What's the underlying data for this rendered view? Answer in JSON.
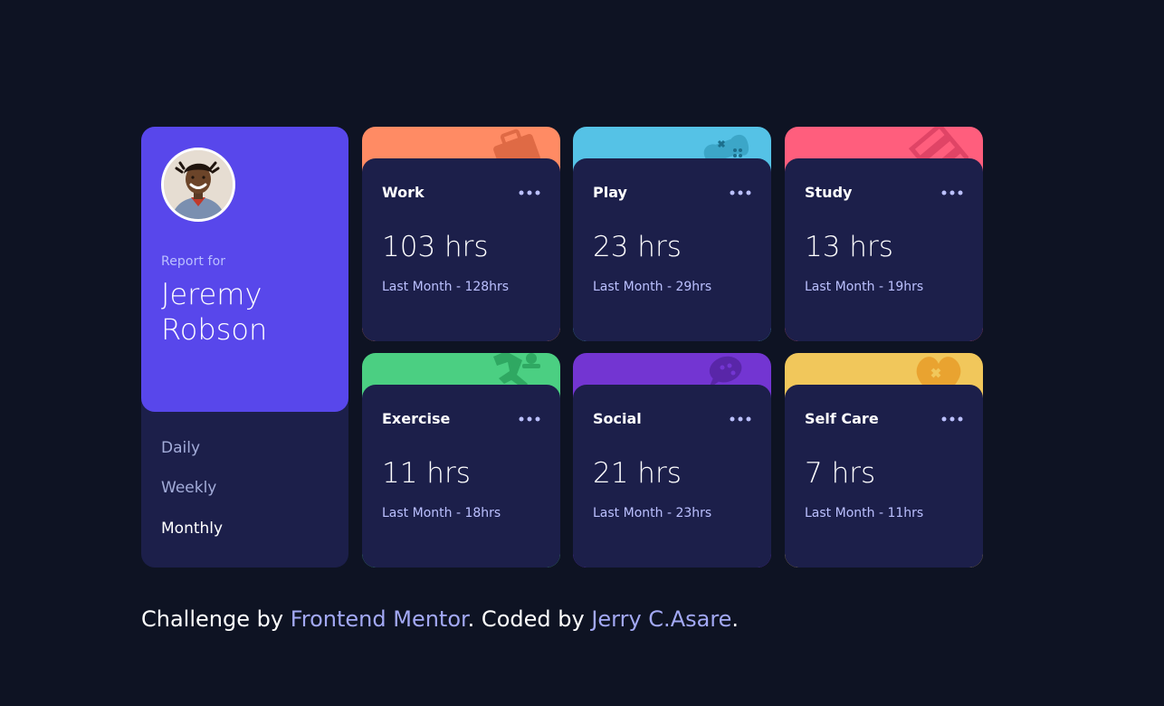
{
  "profile": {
    "report_for": "Report for",
    "name": "Jeremy Robson"
  },
  "periods": [
    "Daily",
    "Weekly",
    "Monthly"
  ],
  "active_period": "Monthly",
  "activities": [
    {
      "title": "Work",
      "current": "103 hrs",
      "previous": "Last Month - 128hrs",
      "color": "#ff8b64",
      "icon": "briefcase-icon"
    },
    {
      "title": "Play",
      "current": "23 hrs",
      "previous": "Last Month - 29hrs",
      "color": "#55c2e6",
      "icon": "gamepad-icon"
    },
    {
      "title": "Study",
      "current": "13 hrs",
      "previous": "Last Month - 19hrs",
      "color": "#ff5e7d",
      "icon": "books-icon"
    },
    {
      "title": "Exercise",
      "current": "11 hrs",
      "previous": "Last Month - 18hrs",
      "color": "#4bcf82",
      "icon": "runner-icon"
    },
    {
      "title": "Social",
      "current": "21 hrs",
      "previous": "Last Month - 23hrs",
      "color": "#7335d2",
      "icon": "chat-bubble-icon"
    },
    {
      "title": "Self Care",
      "current": "7 hrs",
      "previous": "Last Month - 11hrs",
      "color": "#f1c75b",
      "icon": "heart-icon"
    }
  ],
  "footer": {
    "prefix": "Challenge by ",
    "mentor_link": "Frontend Mentor",
    "middle": ". Coded by ",
    "author_link": "Jerry C.Asare",
    "suffix": "."
  },
  "colors": {
    "background": "#0e1323",
    "card": "#1c1f4a",
    "profile_accent": "#5847eb",
    "muted_text": "#bbc0ff"
  }
}
